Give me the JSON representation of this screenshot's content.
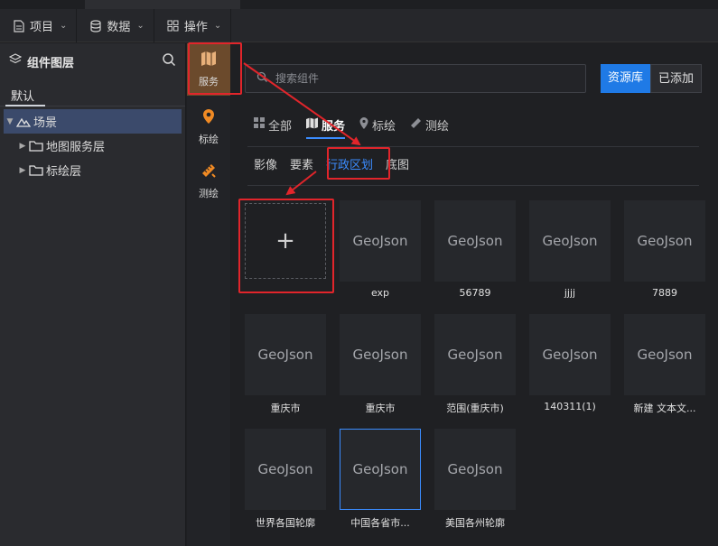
{
  "menubar": {
    "items": [
      {
        "label": "项目",
        "icon": "file-icon"
      },
      {
        "label": "数据",
        "icon": "database-icon"
      },
      {
        "label": "操作",
        "icon": "grid-icon"
      }
    ]
  },
  "layers": {
    "title": "组件图层",
    "tab": "默认",
    "tree": [
      {
        "label": "场景",
        "icon": "mountain-icon",
        "expanded": true,
        "selected": true
      },
      {
        "label": "地图服务层",
        "icon": "folder-icon"
      },
      {
        "label": "标绘层",
        "icon": "folder-icon"
      }
    ]
  },
  "tools": [
    {
      "label": "服务",
      "icon": "map-icon",
      "active": true
    },
    {
      "label": "标绘",
      "icon": "pin-icon"
    },
    {
      "label": "测绘",
      "icon": "ruler-icon"
    }
  ],
  "panel": {
    "search_placeholder": "搜索组件",
    "seg": {
      "library": "资源库",
      "added": "已添加"
    },
    "categories": [
      "全部",
      "服务",
      "标绘",
      "测绘"
    ],
    "subtabs": [
      "影像",
      "要素",
      "行政区划",
      "底图"
    ],
    "add_symbol": "+",
    "cards": [
      {
        "thumb": "GeoJson",
        "name": "exp"
      },
      {
        "thumb": "GeoJson",
        "name": "56789"
      },
      {
        "thumb": "GeoJson",
        "name": "jjjj"
      },
      {
        "thumb": "GeoJson",
        "name": "7889"
      },
      {
        "thumb": "GeoJson",
        "name": "重庆市"
      },
      {
        "thumb": "GeoJson",
        "name": "重庆市"
      },
      {
        "thumb": "GeoJson",
        "name": "范围(重庆市)"
      },
      {
        "thumb": "GeoJson",
        "name": "140311(1)"
      },
      {
        "thumb": "GeoJson",
        "name": "新建 文本文..."
      },
      {
        "thumb": "GeoJson",
        "name": "世界各国轮廓"
      },
      {
        "thumb": "GeoJson",
        "name": "中国各省市..."
      },
      {
        "thumb": "GeoJson",
        "name": "美国各州轮廓"
      }
    ]
  },
  "colors": {
    "accent": "#1f7ae6",
    "highlight": "#e1252b",
    "active_tool": "#6b4a2c"
  }
}
